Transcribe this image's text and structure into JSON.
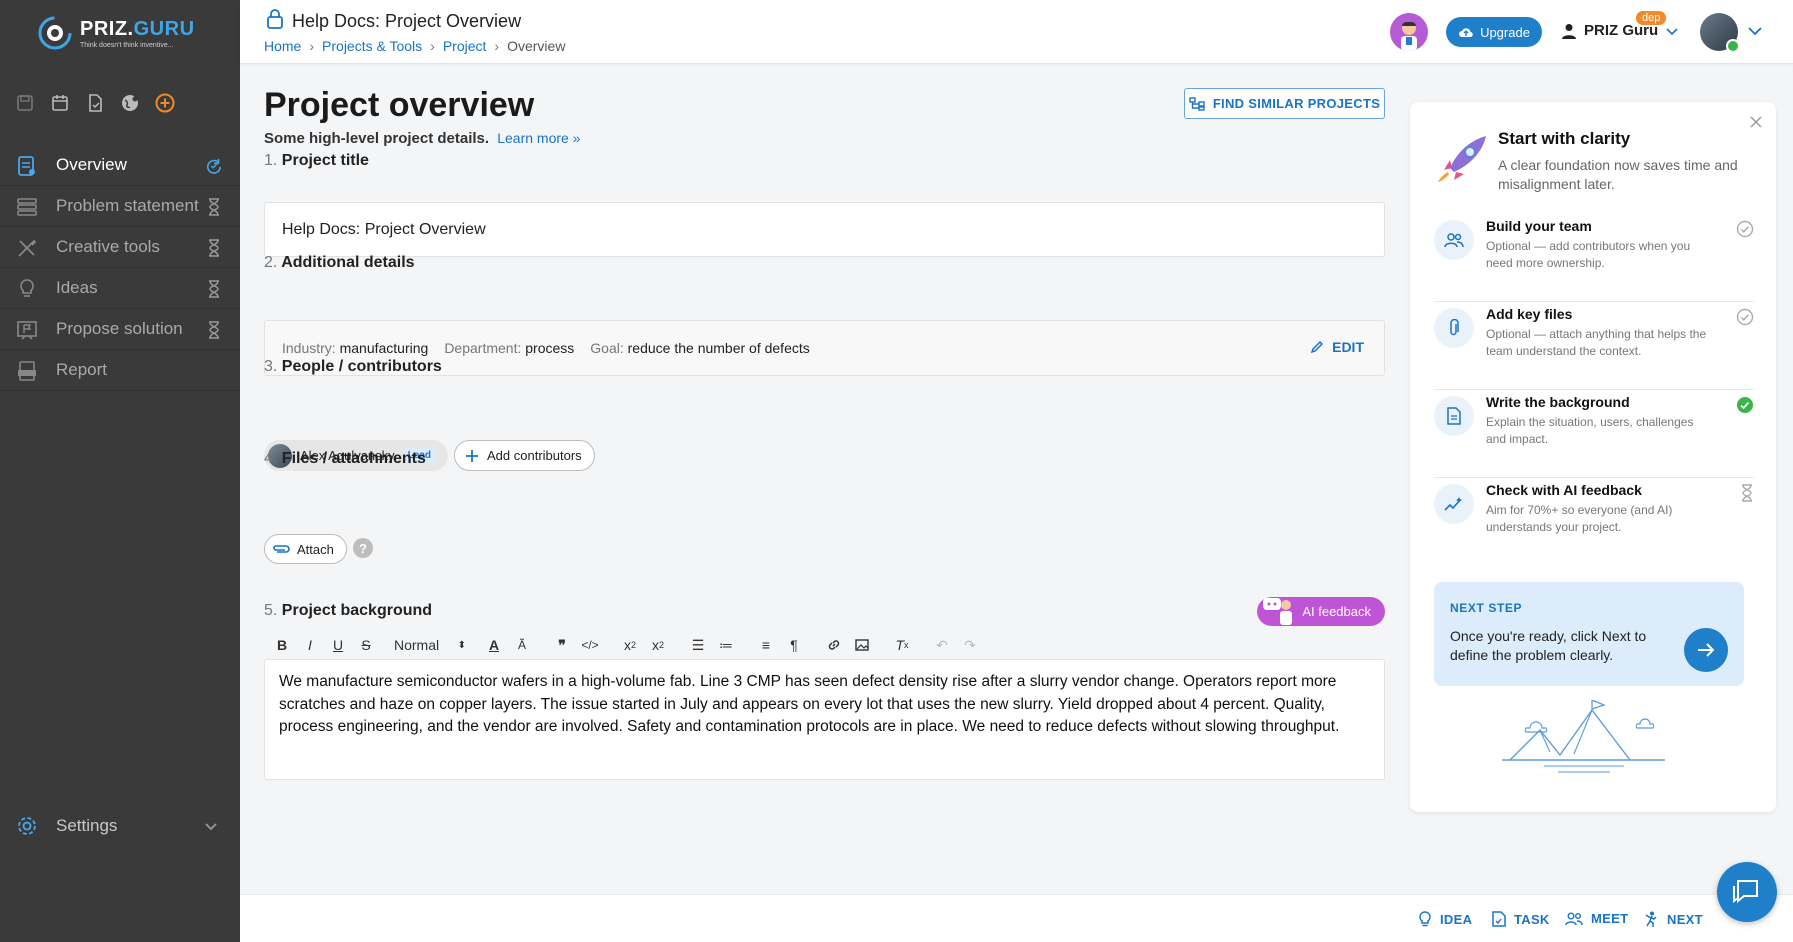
{
  "brand": {
    "name_a": "PRIZ.",
    "name_b": "GURU",
    "tagline": "Think doesn't think inventive..."
  },
  "sidebar": {
    "items": [
      {
        "label": "Overview",
        "active": true
      },
      {
        "label": "Problem statement"
      },
      {
        "label": "Creative tools"
      },
      {
        "label": "Ideas"
      },
      {
        "label": "Propose solution"
      },
      {
        "label": "Report"
      }
    ],
    "settings_label": "Settings"
  },
  "header": {
    "doc_title": "Help Docs: Project Overview",
    "breadcrumbs": [
      "Home",
      "Projects & Tools",
      "Project",
      "Overview"
    ],
    "upgrade_label": "Upgrade",
    "user_name": "PRIZ Guru",
    "badge": "dep"
  },
  "main": {
    "title": "Project overview",
    "subtitle": "Some high-level project details.",
    "learn_more": "Learn more »",
    "find_similar": "FIND SIMILAR PROJECTS",
    "sections": [
      {
        "num": "1.",
        "label": "Project title"
      },
      {
        "num": "2.",
        "label": "Additional details"
      },
      {
        "num": "3.",
        "label": "People / contributors"
      },
      {
        "num": "4.",
        "label": "Files / attachments"
      },
      {
        "num": "5.",
        "label": "Project background"
      }
    ],
    "project_title_value": "Help Docs: Project Overview",
    "details": {
      "industry_label": "Industry:",
      "industry": "manufacturing",
      "department_label": "Department:",
      "department": "process",
      "goal_label": "Goal:",
      "goal": "reduce the number of defects",
      "edit": "EDIT"
    },
    "contributor": {
      "name": "Alex Agulyansky",
      "role": "Lead"
    },
    "add_contributors": "Add contributors",
    "attach": "Attach",
    "help": "?",
    "ai_feedback": "AI feedback",
    "format_select": "Normal",
    "background_text": "We manufacture semiconductor wafers in a high-volume fab. Line 3 CMP has seen defect density rise after a slurry vendor change. Operators report more scratches and haze on copper layers. The issue started in July and appears on every lot that uses the new slurry. Yield dropped about 4 percent. Quality, process engineering, and the vendor are involved. Safety and contamination protocols are in place. We need to reduce defects without slowing throughput."
  },
  "panel": {
    "title": "Start with clarity",
    "lead": "A clear foundation now saves time and misalignment later.",
    "steps": [
      {
        "title": "Build your team",
        "desc": "Optional — add contributors when you need more ownership.",
        "status": "optional-done"
      },
      {
        "title": "Add key files",
        "desc": "Optional — attach anything that helps the team understand the context.",
        "status": "optional-done"
      },
      {
        "title": "Write the background",
        "desc": "Explain the situation, users, challenges and impact.",
        "status": "done"
      },
      {
        "title": "Check with AI feedback",
        "desc": "Aim for 70%+ so everyone (and AI) understands your project.",
        "status": "pending"
      }
    ],
    "next_step_label": "NEXT STEP",
    "next_step_text": "Once you're ready, click Next to define the problem clearly."
  },
  "bottombar": {
    "idea": "IDEA",
    "task": "TASK",
    "meet": "MEET",
    "next": "NEXT"
  },
  "colors": {
    "accent": "#1f7fc8",
    "sidebar": "#3a3a3a",
    "ai": "#c054d6",
    "success": "#3bb54a",
    "badge": "#f08a2a"
  }
}
